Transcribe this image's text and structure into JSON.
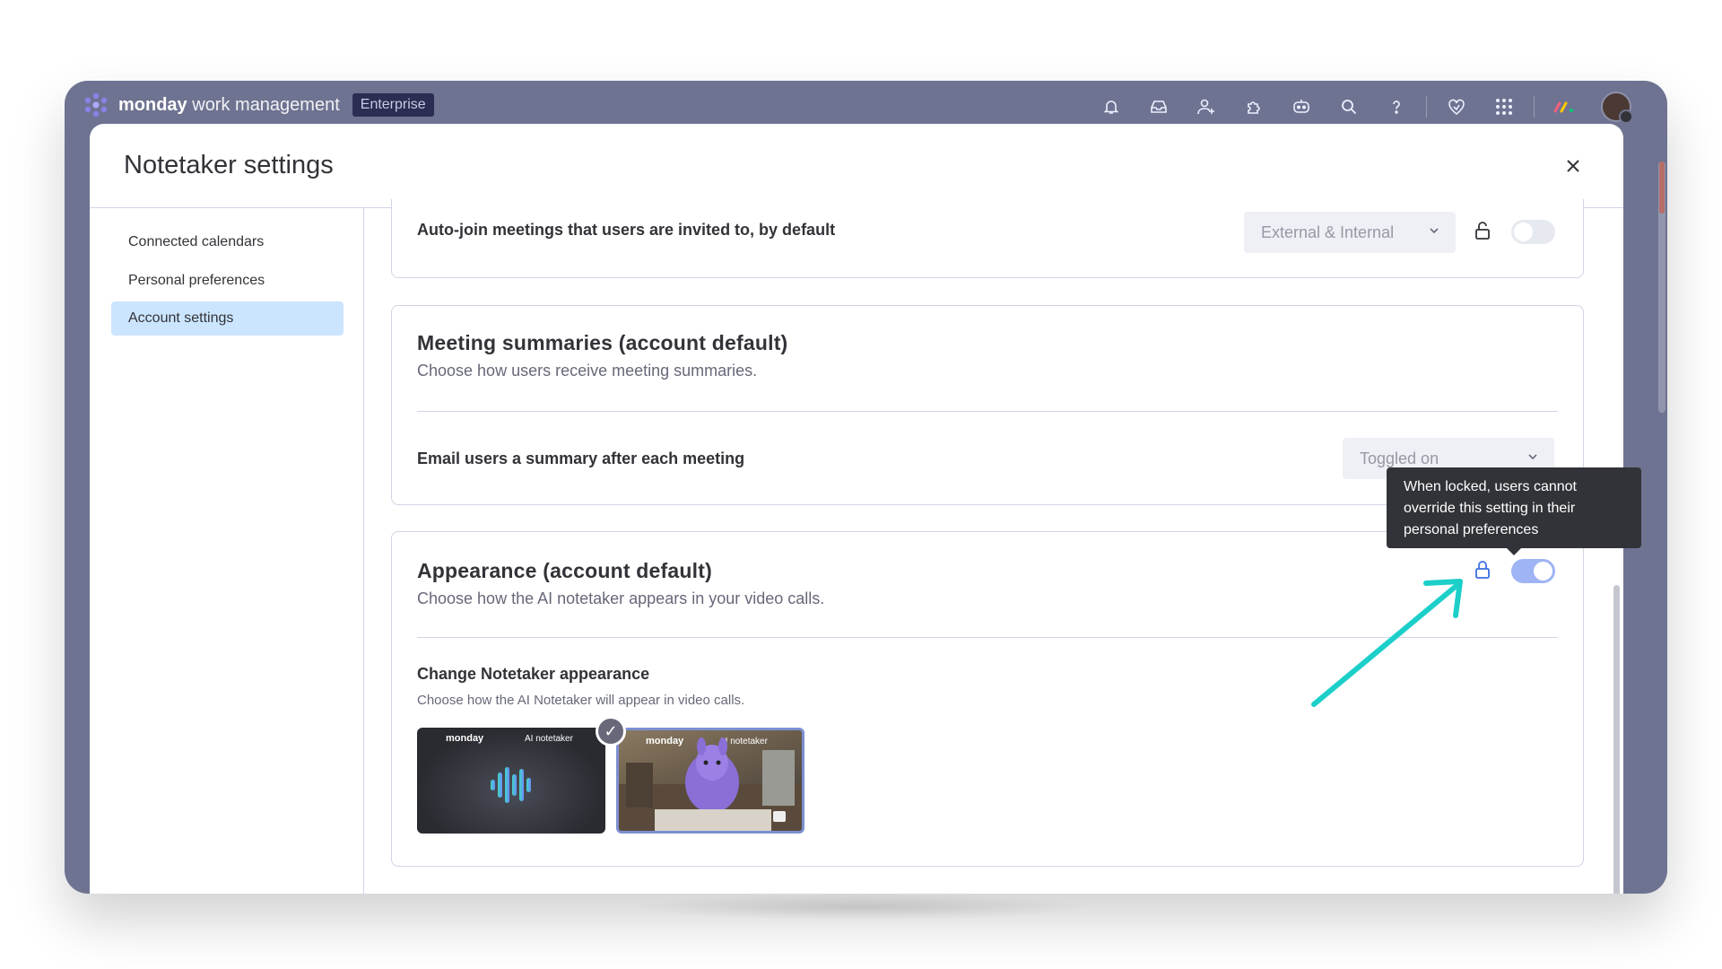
{
  "topbar": {
    "brand_bold": "monday",
    "brand_rest": " work management",
    "plan_badge": "Enterprise",
    "icons": [
      "bell-icon",
      "inbox-icon",
      "invite-icon",
      "apps-icon",
      "ai-icon",
      "search-icon",
      "help-icon",
      "heart-icon",
      "grid-icon",
      "monday-icon"
    ]
  },
  "modal": {
    "title": "Notetaker settings",
    "close_label": "×"
  },
  "sidebar": {
    "items": [
      {
        "label": "Connected calendars"
      },
      {
        "label": "Personal preferences"
      },
      {
        "label": "Account settings"
      }
    ]
  },
  "auto_join": {
    "label": "Auto-join meetings that users are invited to, by default",
    "dropdown_value": "External & Internal",
    "locked": false,
    "toggle_on": false
  },
  "summaries": {
    "title": "Meeting summaries (account default)",
    "description": "Choose how users receive meeting summaries.",
    "email_label": "Email users a summary after each meeting",
    "email_dropdown_value": "Toggled on"
  },
  "appearance": {
    "title": "Appearance (account default)",
    "description": "Choose how the AI notetaker appears in your video calls.",
    "locked": true,
    "toggle_on": true,
    "change_title": "Change Notetaker appearance",
    "change_desc": "Choose how the AI Notetaker will appear in video calls.",
    "options": [
      {
        "brand": "monday",
        "tag": "AI notetaker",
        "selected": true
      },
      {
        "brand": "monday",
        "tag": "AI notetaker",
        "selected": false
      }
    ],
    "check_glyph": "✓"
  },
  "tooltip": {
    "text": "When locked, users cannot override this setting in their personal preferences"
  },
  "colors": {
    "frame": "#6e7391",
    "accent": "#9fb4f4",
    "active_nav": "#cce5ff",
    "annotation_arrow": "#1ccfc9"
  }
}
